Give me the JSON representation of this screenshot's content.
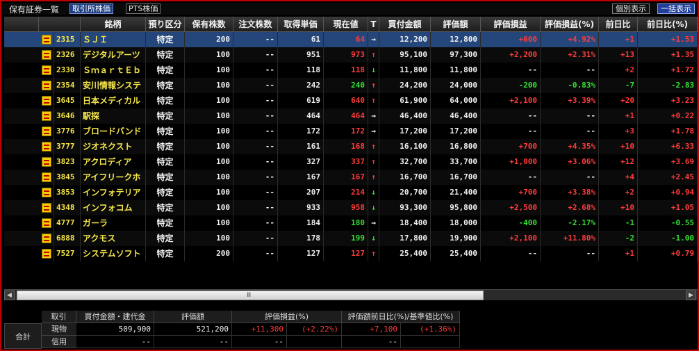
{
  "window": {
    "title": "保有証券一覧",
    "tabs": [
      {
        "label": "取引所株価",
        "active": true
      },
      {
        "label": "PTS株価",
        "active": false
      }
    ],
    "buttons": [
      {
        "label": "個別表示",
        "active": false
      },
      {
        "label": "一括表示",
        "active": true
      }
    ]
  },
  "columns": [
    "",
    "",
    "銘柄",
    "預り区分",
    "保有株数",
    "注文株数",
    "取得単価",
    "現在値",
    "T",
    "買付金額",
    "評価額",
    "評価損益",
    "評価損益(%)",
    "前日比",
    "前日比(%)"
  ],
  "rows": [
    {
      "code": "2315",
      "name": "ＳＪＩ",
      "account": "特定",
      "shares": "200",
      "order": "--",
      "cost": "61",
      "price": "64",
      "trend": "→",
      "buy": "12,200",
      "value": "12,800",
      "pl": "+600",
      "plpct": "+4.92%",
      "chg": "+1",
      "chgpct": "+1.53",
      "pdir": "up",
      "tdir": "neutral",
      "pldir": "up",
      "chgdir": "up",
      "selected": true
    },
    {
      "code": "2326",
      "name": "デジタルアーツ",
      "account": "特定",
      "shares": "100",
      "order": "--",
      "cost": "951",
      "price": "973",
      "trend": "↑",
      "buy": "95,100",
      "value": "97,300",
      "pl": "+2,200",
      "plpct": "+2.31%",
      "chg": "+13",
      "chgpct": "+1.35",
      "pdir": "up",
      "tdir": "up",
      "pldir": "up",
      "chgdir": "up"
    },
    {
      "code": "2330",
      "name": "ＳｍａｒｔＥｂ",
      "account": "特定",
      "shares": "100",
      "order": "--",
      "cost": "118",
      "price": "118",
      "trend": "↓",
      "buy": "11,800",
      "value": "11,800",
      "pl": "--",
      "plpct": "--",
      "chg": "+2",
      "chgpct": "+1.72",
      "pdir": "up",
      "tdir": "down",
      "pldir": "neutral",
      "chgdir": "up"
    },
    {
      "code": "2354",
      "name": "安川情報システ",
      "account": "特定",
      "shares": "100",
      "order": "--",
      "cost": "242",
      "price": "240",
      "trend": "↑",
      "buy": "24,200",
      "value": "24,000",
      "pl": "-200",
      "plpct": "-0.83%",
      "chg": "-7",
      "chgpct": "-2.83",
      "pdir": "down",
      "tdir": "up",
      "pldir": "down",
      "chgdir": "down"
    },
    {
      "code": "3645",
      "name": "日本メディカル",
      "account": "特定",
      "shares": "100",
      "order": "--",
      "cost": "619",
      "price": "640",
      "trend": "↑",
      "buy": "61,900",
      "value": "64,000",
      "pl": "+2,100",
      "plpct": "+3.39%",
      "chg": "+20",
      "chgpct": "+3.23",
      "pdir": "up",
      "tdir": "up",
      "pldir": "up",
      "chgdir": "up"
    },
    {
      "code": "3646",
      "name": "駅探",
      "account": "特定",
      "shares": "100",
      "order": "--",
      "cost": "464",
      "price": "464",
      "trend": "→",
      "buy": "46,400",
      "value": "46,400",
      "pl": "--",
      "plpct": "--",
      "chg": "+1",
      "chgpct": "+0.22",
      "pdir": "up",
      "tdir": "neutral",
      "pldir": "neutral",
      "chgdir": "up"
    },
    {
      "code": "3776",
      "name": "ブロードバンド",
      "account": "特定",
      "shares": "100",
      "order": "--",
      "cost": "172",
      "price": "172",
      "trend": "→",
      "buy": "17,200",
      "value": "17,200",
      "pl": "--",
      "plpct": "--",
      "chg": "+3",
      "chgpct": "+1.78",
      "pdir": "up",
      "tdir": "neutral",
      "pldir": "neutral",
      "chgdir": "up"
    },
    {
      "code": "3777",
      "name": "ジオネクスト",
      "account": "特定",
      "shares": "100",
      "order": "--",
      "cost": "161",
      "price": "168",
      "trend": "↑",
      "buy": "16,100",
      "value": "16,800",
      "pl": "+700",
      "plpct": "+4.35%",
      "chg": "+10",
      "chgpct": "+6.33",
      "pdir": "up",
      "tdir": "up",
      "pldir": "up",
      "chgdir": "up"
    },
    {
      "code": "3823",
      "name": "アクロディア",
      "account": "特定",
      "shares": "100",
      "order": "--",
      "cost": "327",
      "price": "337",
      "trend": "↑",
      "buy": "32,700",
      "value": "33,700",
      "pl": "+1,000",
      "plpct": "+3.06%",
      "chg": "+12",
      "chgpct": "+3.69",
      "pdir": "up",
      "tdir": "up",
      "pldir": "up",
      "chgdir": "up"
    },
    {
      "code": "3845",
      "name": "アイフリークホ",
      "account": "特定",
      "shares": "100",
      "order": "--",
      "cost": "167",
      "price": "167",
      "trend": "↑",
      "buy": "16,700",
      "value": "16,700",
      "pl": "--",
      "plpct": "--",
      "chg": "+4",
      "chgpct": "+2.45",
      "pdir": "up",
      "tdir": "up",
      "pldir": "neutral",
      "chgdir": "up"
    },
    {
      "code": "3853",
      "name": "インフォテリア",
      "account": "特定",
      "shares": "100",
      "order": "--",
      "cost": "207",
      "price": "214",
      "trend": "↓",
      "buy": "20,700",
      "value": "21,400",
      "pl": "+700",
      "plpct": "+3.38%",
      "chg": "+2",
      "chgpct": "+0.94",
      "pdir": "up",
      "tdir": "down",
      "pldir": "up",
      "chgdir": "up"
    },
    {
      "code": "4348",
      "name": "インフォコム",
      "account": "特定",
      "shares": "100",
      "order": "--",
      "cost": "933",
      "price": "958",
      "trend": "↓",
      "buy": "93,300",
      "value": "95,800",
      "pl": "+2,500",
      "plpct": "+2.68%",
      "chg": "+10",
      "chgpct": "+1.05",
      "pdir": "up",
      "tdir": "down",
      "pldir": "up",
      "chgdir": "up"
    },
    {
      "code": "4777",
      "name": "ガーラ",
      "account": "特定",
      "shares": "100",
      "order": "--",
      "cost": "184",
      "price": "180",
      "trend": "→",
      "buy": "18,400",
      "value": "18,000",
      "pl": "-400",
      "plpct": "-2.17%",
      "chg": "-1",
      "chgpct": "-0.55",
      "pdir": "down",
      "tdir": "neutral",
      "pldir": "down",
      "chgdir": "down"
    },
    {
      "code": "6888",
      "name": "アクモス",
      "account": "特定",
      "shares": "100",
      "order": "--",
      "cost": "178",
      "price": "199",
      "trend": "↓",
      "buy": "17,800",
      "value": "19,900",
      "pl": "+2,100",
      "plpct": "+11.80%",
      "chg": "-2",
      "chgpct": "-1.00",
      "pdir": "down",
      "tdir": "down",
      "pldir": "up",
      "chgdir": "down"
    },
    {
      "code": "7527",
      "name": "システムソフト",
      "account": "特定",
      "shares": "200",
      "order": "--",
      "cost": "127",
      "price": "127",
      "trend": "↑",
      "buy": "25,400",
      "value": "25,400",
      "pl": "--",
      "plpct": "--",
      "chg": "+1",
      "chgpct": "+0.79",
      "pdir": "up",
      "tdir": "up",
      "pldir": "neutral",
      "chgdir": "up"
    }
  ],
  "scrollbar": {
    "grip": "Ⅲ",
    "left": "◀",
    "right": "▶"
  },
  "summary": {
    "label": "合計",
    "headers": [
      "取引",
      "買付金額・建代金",
      "評価額",
      "評価損益(%)",
      "評価額前日比(%)/基準値比(%)"
    ],
    "rows": [
      {
        "label": "現物",
        "buy": "509,900",
        "value": "521,200",
        "pl": "+11,300",
        "plpct": "(+2.22%)",
        "chg": "+7,100",
        "chgpct": "(+1.36%)"
      },
      {
        "label": "信用",
        "buy": "--",
        "value": "--",
        "pl": "--",
        "plpct": "",
        "chg": "--",
        "chgpct": ""
      }
    ]
  },
  "colors": {
    "up": "#ff3b3b",
    "down": "#34e034",
    "accent": "#1e3d82",
    "border": "#c00000",
    "name": "#f5e64a"
  }
}
